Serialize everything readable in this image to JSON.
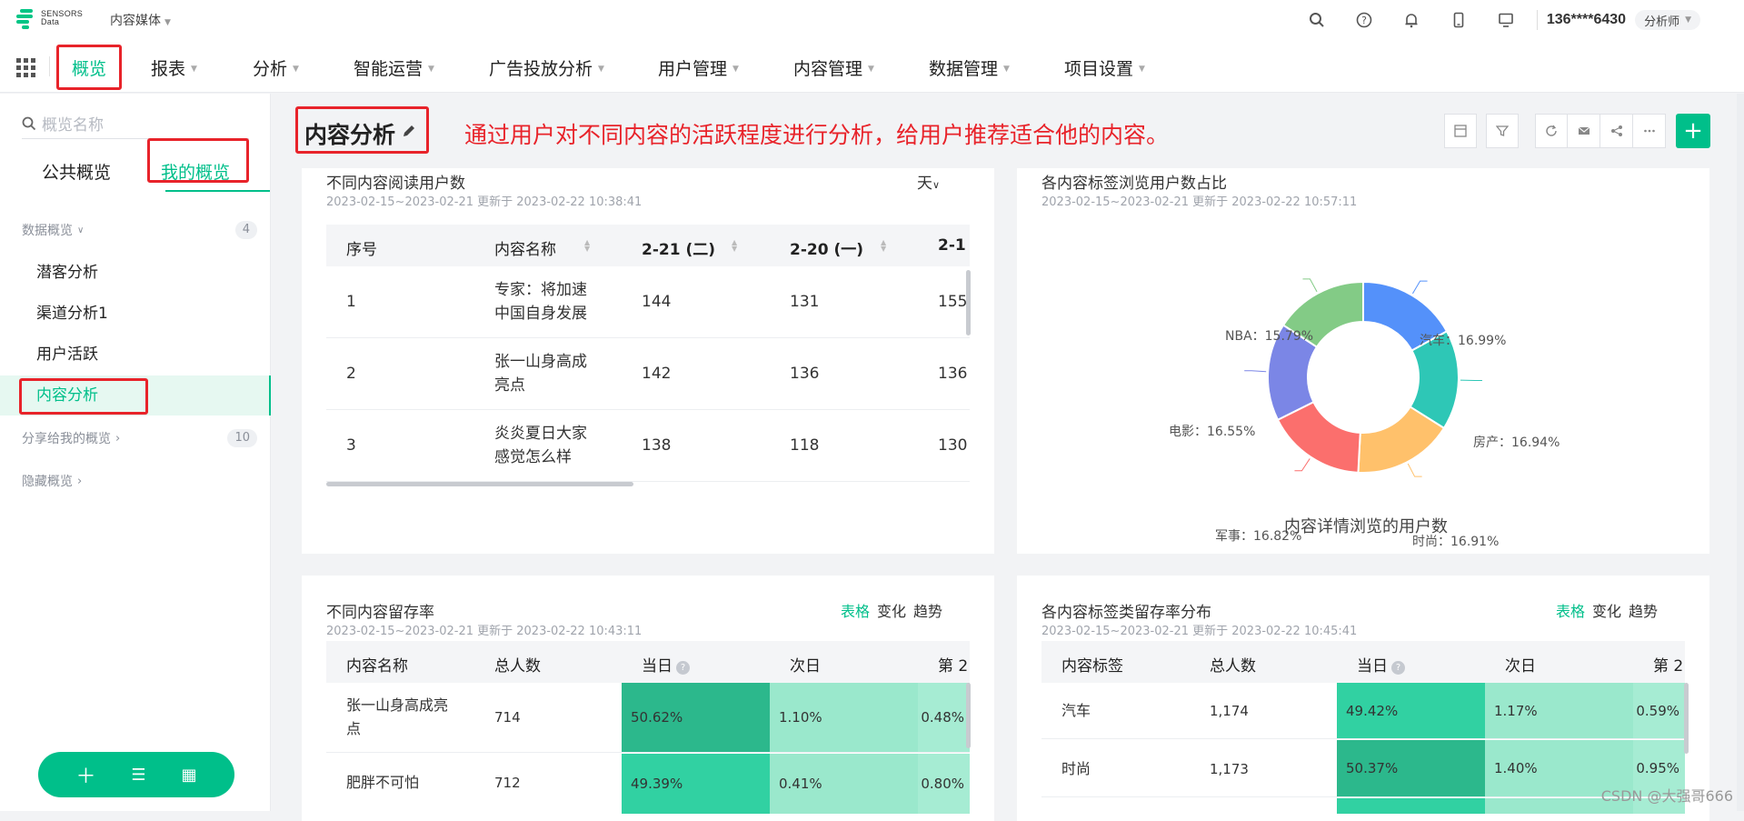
{
  "brand": {
    "line1": "SENSORS",
    "line2": "Data"
  },
  "project": {
    "name": "内容媒体"
  },
  "header": {
    "user": "136****6430",
    "role": "分析师",
    "icons": [
      "search-icon",
      "help-icon",
      "bell-icon",
      "mobile-icon",
      "monitor-icon"
    ]
  },
  "nav": {
    "items": [
      {
        "label": "概览"
      },
      {
        "label": "报表"
      },
      {
        "label": "分析"
      },
      {
        "label": "智能运营"
      },
      {
        "label": "广告投放分析"
      },
      {
        "label": "用户管理"
      },
      {
        "label": "内容管理"
      },
      {
        "label": "数据管理"
      },
      {
        "label": "项目设置"
      }
    ]
  },
  "sidebar": {
    "search_placeholder": "概览名称",
    "tabs": {
      "public": "公共概览",
      "mine": "我的概览"
    },
    "group_data": {
      "label": "数据概览",
      "count": "4"
    },
    "items": [
      {
        "label": "潜客分析"
      },
      {
        "label": "渠道分析1"
      },
      {
        "label": "用户活跃"
      },
      {
        "label": "内容分析"
      }
    ],
    "group_shared": {
      "label": "分享给我的概览",
      "count": "10"
    },
    "group_hidden": {
      "label": "隐藏概览"
    }
  },
  "page": {
    "title": "内容分析",
    "description": "通过用户对不同内容的活跃程度进行分析，给用户推荐适合他的内容。"
  },
  "card1": {
    "title": "不同内容阅读用户数",
    "subtitle": "2023-02-15~2023-02-21 更新于 2023-02-22 10:38:41",
    "granularity": "天",
    "headers": [
      "序号",
      "内容名称",
      "2-21 (二)",
      "2-20 (一)",
      "2-1"
    ],
    "rows": [
      {
        "idx": "1",
        "name1": "专家：将加速",
        "name2": "中国自身发展",
        "v1": "144",
        "v2": "131",
        "v3": "155"
      },
      {
        "idx": "2",
        "name1": "张一山身高成",
        "name2": "亮点",
        "v1": "142",
        "v2": "136",
        "v3": "136"
      },
      {
        "idx": "3",
        "name1": "炎炎夏日大家",
        "name2": "感觉怎么样",
        "v1": "138",
        "v2": "118",
        "v3": "130"
      }
    ]
  },
  "card2": {
    "title": "各内容标签浏览用户数占比",
    "subtitle": "2023-02-15~2023-02-21 更新于 2023-02-22 10:57:11",
    "chart_caption": "内容详情浏览的用户数"
  },
  "chart_data": {
    "type": "pie",
    "donut": true,
    "categories": [
      "汽车",
      "房产",
      "时尚",
      "军事",
      "电影",
      "NBA"
    ],
    "values": [
      16.99,
      16.94,
      16.91,
      16.82,
      16.55,
      15.79
    ],
    "labels": [
      "汽车：16.99%",
      "房产：16.94%",
      "时尚：16.91%",
      "军事：16.82%",
      "电影：16.55%",
      "NBA：15.79%"
    ],
    "colors": [
      "#5491fa",
      "#2ec7b6",
      "#ffc16b",
      "#fb6f6d",
      "#7b86e6",
      "#83cb86"
    ],
    "title": "内容详情浏览的用户数"
  },
  "card3": {
    "title": "不同内容留存率",
    "subtitle": "2023-02-15~2023-02-21 更新于 2023-02-22 10:43:11",
    "views": [
      "表格",
      "变化",
      "趋势"
    ],
    "headers": [
      "内容名称",
      "总人数",
      "当日",
      "次日",
      "第 2"
    ],
    "rows": [
      {
        "name1": "张一山身高成亮",
        "name2": "点",
        "total": "714",
        "d0": "50.62%",
        "d1": "1.10%",
        "d2": "0.48%"
      },
      {
        "name1": "肥胖不可怕",
        "name2": "",
        "total": "712",
        "d0": "49.39%",
        "d1": "0.41%",
        "d2": "0.80%"
      }
    ]
  },
  "card4": {
    "title": "各内容标签类留存率分布",
    "subtitle": "2023-02-15~2023-02-21 更新于 2023-02-22 10:45:41",
    "views": [
      "表格",
      "变化",
      "趋势"
    ],
    "headers": [
      "内容标签",
      "总人数",
      "当日",
      "次日",
      "第 2"
    ],
    "rows": [
      {
        "name": "汽车",
        "total": "1,174",
        "d0": "49.42%",
        "d1": "1.17%",
        "d2": "0.59%"
      },
      {
        "name": "时尚",
        "total": "1,173",
        "d0": "50.37%",
        "d1": "1.40%",
        "d2": "0.95%"
      }
    ]
  },
  "watermark": "CSDN @大强哥666"
}
